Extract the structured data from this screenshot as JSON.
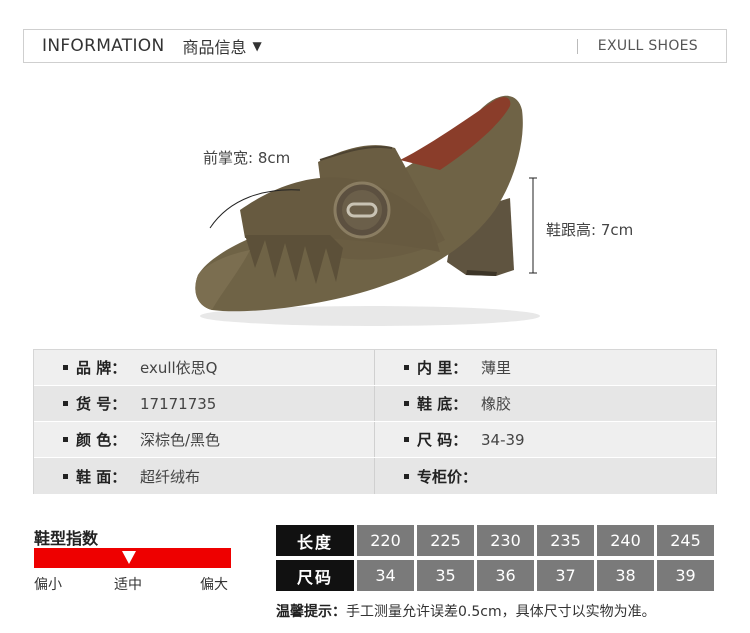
{
  "header": {
    "title_en": "INFORMATION",
    "title_cn": "商品信息",
    "caret": "▼",
    "brand": "EXULL SHOES"
  },
  "dimensions": {
    "front_width": "前掌宽: 8cm",
    "heel_height": "鞋跟高: 7cm"
  },
  "specs": [
    {
      "key": "品  牌：",
      "value": "exull依思Q",
      "key2": "内  里：",
      "value2": "薄里"
    },
    {
      "key": "货  号：",
      "value": "17171735",
      "key2": "鞋  底：",
      "value2": "橡胶"
    },
    {
      "key": "颜  色：",
      "value": "深棕色/黑色",
      "key2": "尺  码：",
      "value2": "34-39"
    },
    {
      "key": "鞋  面：",
      "value": "超纤绒布",
      "key2": "专柜价：",
      "value2": ""
    }
  ],
  "fit": {
    "title": "鞋型指数",
    "small": "偏小",
    "mid": "适中",
    "large": "偏大",
    "position": "mid"
  },
  "size_table": {
    "length_label": "长度",
    "size_label": "尺码",
    "lengths": [
      "220",
      "225",
      "230",
      "235",
      "240",
      "245"
    ],
    "sizes": [
      "34",
      "35",
      "36",
      "37",
      "38",
      "39"
    ]
  },
  "tip": {
    "label": "温馨提示：",
    "text": "手工测量允许误差0.5cm，具体尺寸以实物为准。"
  },
  "colors": {
    "shoe": "#6f6346",
    "accent": "#ee0000",
    "size_cell": "#7a7a7a"
  }
}
